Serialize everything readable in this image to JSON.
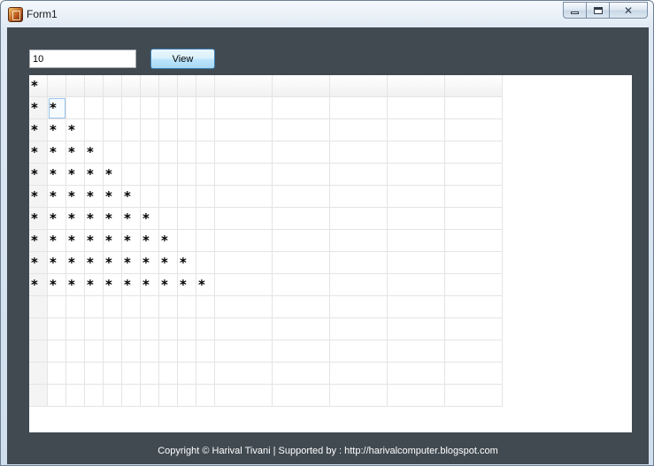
{
  "window": {
    "title": "Form1",
    "buttons": {
      "minimize": "minimize-icon",
      "maximize": "maximize-icon",
      "close": "close-icon"
    }
  },
  "controls": {
    "input_value": "10",
    "view_label": "View"
  },
  "grid": {
    "rows": [
      [
        "*",
        "",
        "",
        "",
        "",
        "",
        "",
        "",
        "",
        "",
        "",
        "",
        "",
        "",
        ""
      ],
      [
        "*",
        "*",
        "",
        "",
        "",
        "",
        "",
        "",
        "",
        "",
        "",
        "",
        "",
        "",
        ""
      ],
      [
        "*",
        "*",
        "*",
        "",
        "",
        "",
        "",
        "",
        "",
        "",
        "",
        "",
        "",
        "",
        ""
      ],
      [
        "*",
        "*",
        "*",
        "*",
        "",
        "",
        "",
        "",
        "",
        "",
        "",
        "",
        "",
        "",
        ""
      ],
      [
        "*",
        "*",
        "*",
        "*",
        "*",
        "",
        "",
        "",
        "",
        "",
        "",
        "",
        "",
        "",
        ""
      ],
      [
        "*",
        "*",
        "*",
        "*",
        "*",
        "*",
        "",
        "",
        "",
        "",
        "",
        "",
        "",
        "",
        ""
      ],
      [
        "*",
        "*",
        "*",
        "*",
        "*",
        "*",
        "*",
        "",
        "",
        "",
        "",
        "",
        "",
        "",
        ""
      ],
      [
        "*",
        "*",
        "*",
        "*",
        "*",
        "*",
        "*",
        "*",
        "",
        "",
        "",
        "",
        "",
        "",
        ""
      ],
      [
        "*",
        "*",
        "*",
        "*",
        "*",
        "*",
        "*",
        "*",
        "*",
        "",
        "",
        "",
        "",
        "",
        ""
      ],
      [
        "*",
        "*",
        "*",
        "*",
        "*",
        "*",
        "*",
        "*",
        "*",
        "*",
        "",
        "",
        "",
        "",
        ""
      ],
      [
        "",
        "",
        "",
        "",
        "",
        "",
        "",
        "",
        "",
        "",
        "",
        "",
        "",
        "",
        ""
      ],
      [
        "",
        "",
        "",
        "",
        "",
        "",
        "",
        "",
        "",
        "",
        "",
        "",
        "",
        "",
        ""
      ],
      [
        "",
        "",
        "",
        "",
        "",
        "",
        "",
        "",
        "",
        "",
        "",
        "",
        "",
        "",
        ""
      ],
      [
        "",
        "",
        "",
        "",
        "",
        "",
        "",
        "",
        "",
        "",
        "",
        "",
        "",
        "",
        ""
      ],
      [
        "",
        "",
        "",
        "",
        "",
        "",
        "",
        "",
        "",
        "",
        "",
        "",
        "",
        "",
        ""
      ]
    ]
  },
  "footer": {
    "text": "Copyright © Harival Tivani | Supported by : http://harivalcomputer.blogspot.com"
  }
}
